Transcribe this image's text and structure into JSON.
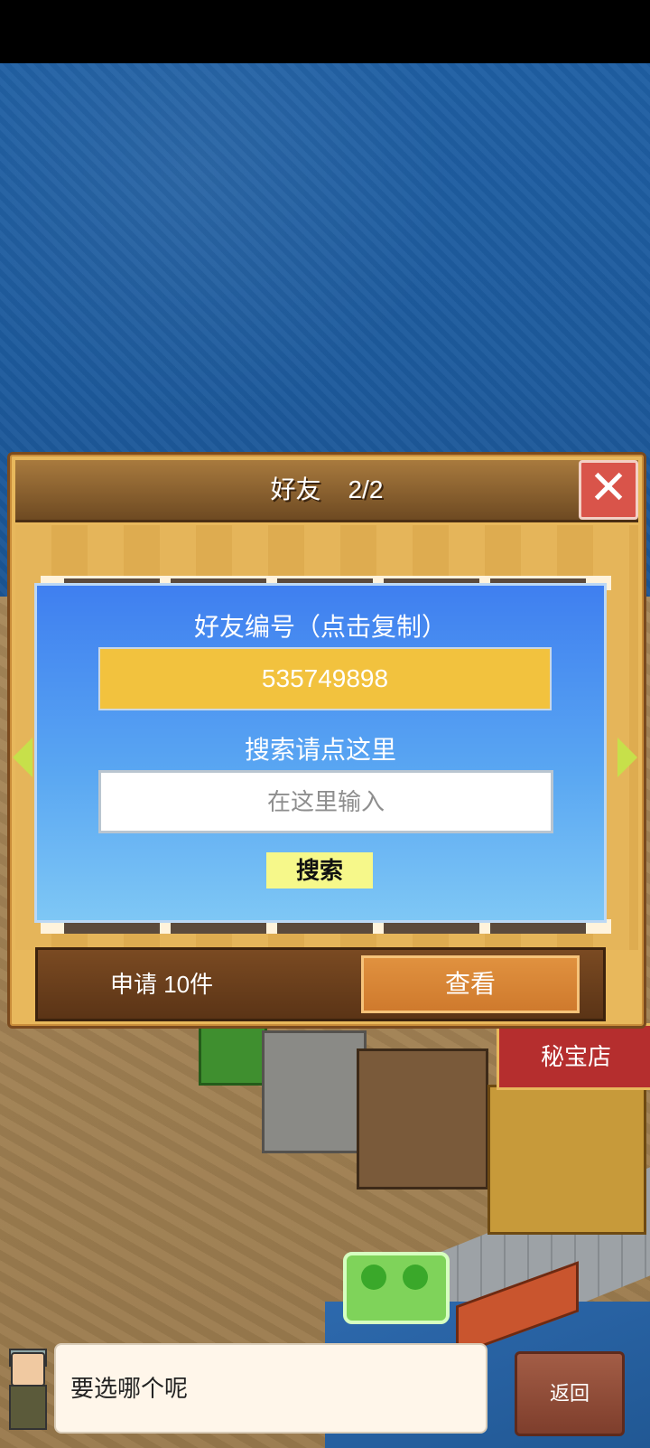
{
  "dialog": {
    "title": "好友",
    "page_indicator": "2/2"
  },
  "friend_panel": {
    "id_label": "好友编号（点击复制）",
    "friend_id": "535749898",
    "search_label": "搜索请点这里",
    "search_placeholder": "在这里输入",
    "search_button": "搜索"
  },
  "requests": {
    "label": "申请 10件",
    "view_button": "查看"
  },
  "map": {
    "shop_sign": "秘宝店"
  },
  "speech": {
    "text": "要选哪个呢"
  },
  "back_button": "返回",
  "colors": {
    "panel_top": "#3f7ff0",
    "id_field": "#f2c23e",
    "close": "#d9544a",
    "view_button": "#e0913f"
  }
}
